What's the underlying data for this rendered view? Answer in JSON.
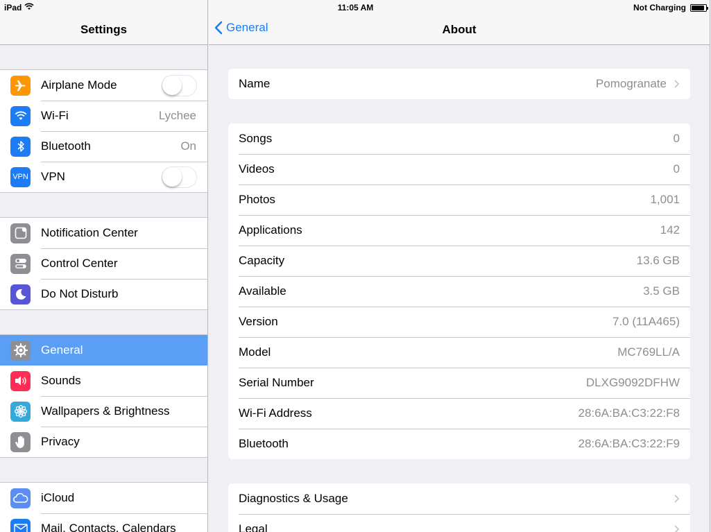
{
  "status_bar": {
    "device": "iPad",
    "time": "11:05 AM",
    "charging": "Not Charging"
  },
  "left": {
    "title": "Settings",
    "groups": [
      [
        {
          "label": "Airplane Mode",
          "icon": "airplane-icon",
          "color": "#ff9500"
        },
        {
          "label": "Wi-Fi",
          "value": "Lychee",
          "icon": "wifi-icon",
          "color": "#1c7cf4"
        },
        {
          "label": "Bluetooth",
          "value": "On",
          "icon": "bluetooth-icon",
          "color": "#1c7cf4"
        },
        {
          "label": "VPN",
          "icon": "vpn-icon",
          "icon_text": "VPN",
          "color": "#1c7cf4"
        }
      ],
      [
        {
          "label": "Notification Center",
          "icon": "notification-center-icon",
          "color": "#8e8e93"
        },
        {
          "label": "Control Center",
          "icon": "control-center-icon",
          "color": "#8e8e93"
        },
        {
          "label": "Do Not Disturb",
          "icon": "moon-icon",
          "color": "#5856d6"
        }
      ],
      [
        {
          "label": "General",
          "icon": "gear-icon",
          "color": "#8e8e93",
          "selected": true
        },
        {
          "label": "Sounds",
          "icon": "speaker-icon",
          "color": "#ff2d55"
        },
        {
          "label": "Wallpapers & Brightness",
          "icon": "flower-icon",
          "color": "#34aadc"
        },
        {
          "label": "Privacy",
          "icon": "hand-icon",
          "color": "#8e8e93"
        }
      ],
      [
        {
          "label": "iCloud",
          "icon": "cloud-icon",
          "color": "#5b8ef0"
        },
        {
          "label": "Mail, Contacts, Calendars",
          "icon": "envelope-icon",
          "color": "#1c7cf4"
        }
      ]
    ]
  },
  "right": {
    "back_label": "General",
    "title": "About",
    "name_row": {
      "label": "Name",
      "value": "Pomogranate"
    },
    "info_rows": [
      {
        "label": "Songs",
        "value": "0"
      },
      {
        "label": "Videos",
        "value": "0"
      },
      {
        "label": "Photos",
        "value": "1,001"
      },
      {
        "label": "Applications",
        "value": "142"
      },
      {
        "label": "Capacity",
        "value": "13.6 GB"
      },
      {
        "label": "Available",
        "value": "3.5 GB"
      },
      {
        "label": "Version",
        "value": "7.0 (11A465)"
      },
      {
        "label": "Model",
        "value": "MC769LL/A"
      },
      {
        "label": "Serial Number",
        "value": "DLXG9092DFHW"
      },
      {
        "label": "Wi-Fi Address",
        "value": "28:6A:BA:C3:22:F8"
      },
      {
        "label": "Bluetooth",
        "value": "28:6A:BA:C3:22:F9"
      }
    ],
    "links": [
      {
        "label": "Diagnostics & Usage"
      },
      {
        "label": "Legal"
      }
    ]
  },
  "colors": {
    "accent": "#1c7cf4",
    "selected": "#5b9ff5"
  }
}
